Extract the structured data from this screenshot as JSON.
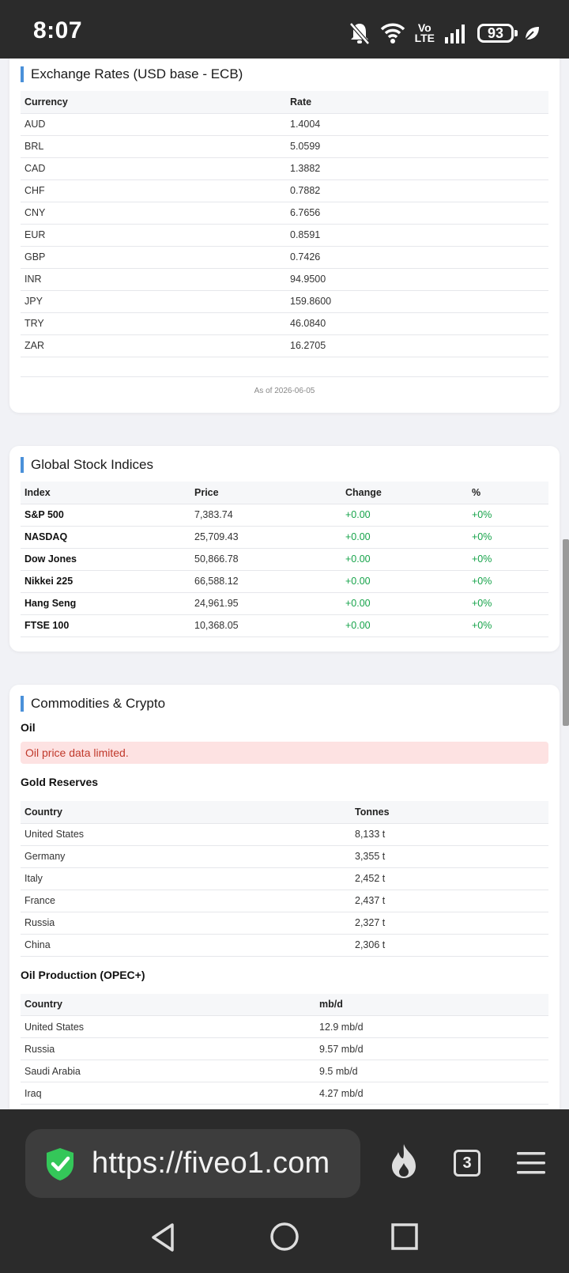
{
  "status_bar": {
    "time": "8:07",
    "volte_top": "Vo",
    "volte_bottom": "LTE",
    "battery": "93",
    "icons": [
      "mute-bell-icon",
      "wifi-icon",
      "volte-icon",
      "signal-icon",
      "battery-icon",
      "leaf-icon"
    ]
  },
  "exchange": {
    "title": "Exchange Rates (USD base - ECB)",
    "columns": [
      "Currency",
      "Rate"
    ],
    "rows": [
      [
        "AUD",
        "1.4004"
      ],
      [
        "BRL",
        "5.0599"
      ],
      [
        "CAD",
        "1.3882"
      ],
      [
        "CHF",
        "0.7882"
      ],
      [
        "CNY",
        "6.7656"
      ],
      [
        "EUR",
        "0.8591"
      ],
      [
        "GBP",
        "0.7426"
      ],
      [
        "INR",
        "94.9500"
      ],
      [
        "JPY",
        "159.8600"
      ],
      [
        "TRY",
        "46.0840"
      ],
      [
        "ZAR",
        "16.2705"
      ]
    ],
    "as_of": "As of 2026-06-05"
  },
  "indices": {
    "title": "Global Stock Indices",
    "columns": [
      "Index",
      "Price",
      "Change",
      "%"
    ],
    "rows": [
      [
        "S&P 500",
        "7,383.74",
        "+0.00",
        "+0%"
      ],
      [
        "NASDAQ",
        "25,709.43",
        "+0.00",
        "+0%"
      ],
      [
        "Dow Jones",
        "50,866.78",
        "+0.00",
        "+0%"
      ],
      [
        "Nikkei 225",
        "66,588.12",
        "+0.00",
        "+0%"
      ],
      [
        "Hang Seng",
        "24,961.95",
        "+0.00",
        "+0%"
      ],
      [
        "FTSE 100",
        "10,368.05",
        "+0.00",
        "+0%"
      ]
    ]
  },
  "commodities": {
    "title": "Commodities & Crypto",
    "oil_heading": "Oil",
    "oil_alert": "Oil price data limited.",
    "gold_heading": "Gold Reserves",
    "gold_columns": [
      "Country",
      "Tonnes"
    ],
    "gold_rows": [
      [
        "United States",
        "8,133 t"
      ],
      [
        "Germany",
        "3,355 t"
      ],
      [
        "Italy",
        "2,452 t"
      ],
      [
        "France",
        "2,437 t"
      ],
      [
        "Russia",
        "2,327 t"
      ],
      [
        "China",
        "2,306 t"
      ]
    ],
    "opec_heading": "Oil Production (OPEC+)",
    "opec_columns": [
      "Country",
      "mb/d"
    ],
    "opec_rows": [
      [
        "United States",
        "12.9 mb/d"
      ],
      [
        "Russia",
        "9.57 mb/d"
      ],
      [
        "Saudi Arabia",
        "9.5 mb/d"
      ],
      [
        "Iraq",
        "4.27 mb/d"
      ]
    ]
  },
  "browser": {
    "url": "https://fiveo1.com",
    "tab_count": "3"
  },
  "colors": {
    "accent": "#4a90d9",
    "positive": "#16a34a",
    "alert_bg": "#fde2e2",
    "alert_text": "#c0392b",
    "chrome_bg": "#2b2b2b"
  }
}
